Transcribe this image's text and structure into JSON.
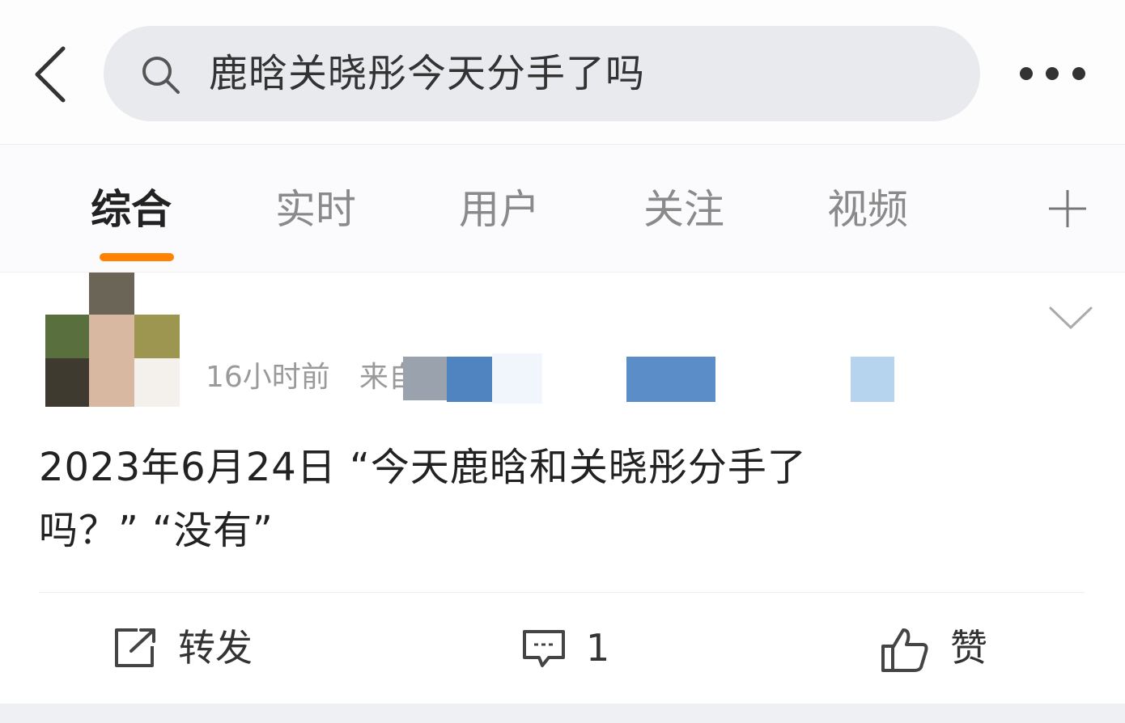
{
  "header": {
    "search_query": "鹿晗关晓彤今天分手了吗",
    "back_icon": "chevron-left-icon",
    "search_icon": "search-icon",
    "more_icon": "more-dots-icon"
  },
  "tabs": [
    {
      "label": "综合",
      "active": true
    },
    {
      "label": "实时",
      "active": false
    },
    {
      "label": "用户",
      "active": false
    },
    {
      "label": "关注",
      "active": false
    },
    {
      "label": "视频",
      "active": false
    }
  ],
  "tab_add_icon": "plus-icon",
  "accent_color": "#ff8200",
  "post": {
    "time": "16小时前",
    "source_prefix": "来自",
    "text_line1": "2023年6月24日 “今天鹿晗和关晓彤分手了",
    "text_line2": "吗？”  “没有”",
    "actions": {
      "repost_label": "转发",
      "comment_count": "1",
      "like_label": "赞"
    }
  }
}
